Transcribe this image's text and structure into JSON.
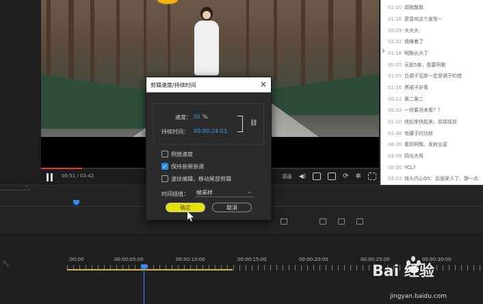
{
  "player": {
    "time": "00:51 / 03:42",
    "quality_label": "原画"
  },
  "comments": [
    {
      "t": "01:10",
      "c": "颂歌飘飘"
    },
    {
      "t": "01:16",
      "c": "更喜欢这个发型~"
    },
    {
      "t": "00:29",
      "c": "大大大"
    },
    {
      "t": "02:32",
      "c": "快睡着了"
    },
    {
      "t": "01:18",
      "c": "啊飘长大了"
    },
    {
      "t": "00:05",
      "c": "无题5痕，我要阿紫"
    },
    {
      "t": "01:05",
      "c": "白裙子显胖一定是裙子的错"
    },
    {
      "t": "01:16",
      "c": "黑裙子好看"
    },
    {
      "t": "00:11",
      "c": "第二第二"
    },
    {
      "t": "00:33",
      "c": "一你要进来看？？"
    },
    {
      "t": "01:10",
      "c": "快起来快起来。叔叔叔叔"
    },
    {
      "t": "01:48",
      "c": "有腰子的功效"
    },
    {
      "t": "00:16",
      "c": "看到啊飘、发射五星"
    },
    {
      "t": "03:09",
      "c": "四光大哥"
    },
    {
      "t": "00:30",
      "c": "YCL?"
    },
    {
      "t": "02:03",
      "c": "钱头内心OS：后面来人了，静一点"
    }
  ],
  "dialog": {
    "title": "剪辑速度/持续时间",
    "close": "×",
    "speed_label": "速度：",
    "speed_value": "30",
    "speed_unit": "%",
    "duration_label": "持续时间：",
    "duration_value": "00:00:24:03",
    "link_icon": "link-icon",
    "reverse_label": "倒放速度",
    "reverse_checked": false,
    "keep_pitch_label": "保持音频音调",
    "keep_pitch_checked": true,
    "ripple_label": "波纹编辑，移动尾部剪辑",
    "ripple_checked": false,
    "interp_label": "时间插值：",
    "interp_value": "帧采样",
    "ok_label": "确定",
    "cancel_label": "取消"
  },
  "timeline": {
    "ruler": [
      ":00:00",
      "00:00:05:00",
      "00:00:10:00",
      "00:00:15:00",
      "00:00:20:00",
      "00:00:25:00",
      "00:00:30:00"
    ],
    "accent": "#2d8ceb",
    "work_area_color": "#d9b64a"
  },
  "watermark": {
    "brand": "Bai  经验",
    "url": "jingyan.baidu.com"
  }
}
